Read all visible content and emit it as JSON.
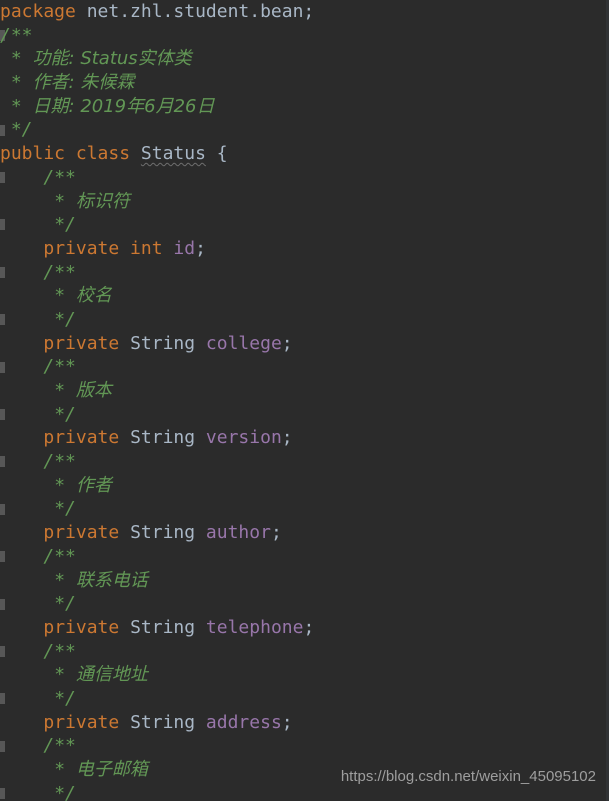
{
  "editor": {
    "theme_name": "darcula",
    "background_color": "#2b2b2b",
    "language": "java",
    "colors": {
      "keyword": "#cc7832",
      "identifier": "#a9b7c6",
      "field": "#9876aa",
      "javadoc": "#629755",
      "gutter_marker": "#575757",
      "watermark": "#9e9e9e"
    }
  },
  "watermark": {
    "text": "https://blog.csdn.net/weixin_45095102"
  },
  "code": {
    "lines": [
      {
        "indent": "",
        "tokens": [
          {
            "class": "kw",
            "text": "package"
          },
          {
            "class": "plain",
            "text": " net.zhl.student.bean;"
          }
        ]
      },
      {
        "indent": "",
        "fold": true,
        "tokens": [
          {
            "class": "doc",
            "text": "/**"
          }
        ]
      },
      {
        "indent": " ",
        "tokens": [
          {
            "class": "doc",
            "text": "* "
          },
          {
            "class": "doc-cn",
            "text": "功能: Status实体类"
          }
        ]
      },
      {
        "indent": " ",
        "tokens": [
          {
            "class": "doc",
            "text": "* "
          },
          {
            "class": "doc-cn",
            "text": "作者: 朱候霖"
          }
        ]
      },
      {
        "indent": " ",
        "tokens": [
          {
            "class": "doc",
            "text": "* "
          },
          {
            "class": "doc-cn",
            "text": "日期: 2019年6月26日"
          }
        ]
      },
      {
        "indent": " ",
        "fold": true,
        "tokens": [
          {
            "class": "doc",
            "text": "*/"
          }
        ]
      },
      {
        "indent": "",
        "tokens": [
          {
            "class": "kw",
            "text": "public class "
          },
          {
            "class": "warnref",
            "text": "Status"
          },
          {
            "class": "plain",
            "text": " {"
          }
        ]
      },
      {
        "indent": "    ",
        "fold": true,
        "tokens": [
          {
            "class": "doc",
            "text": "/**"
          }
        ]
      },
      {
        "indent": "     ",
        "tokens": [
          {
            "class": "doc",
            "text": "* "
          },
          {
            "class": "doc-cn",
            "text": "标识符"
          }
        ]
      },
      {
        "indent": "     ",
        "fold": true,
        "tokens": [
          {
            "class": "doc",
            "text": "*/"
          }
        ]
      },
      {
        "indent": "    ",
        "tokens": [
          {
            "class": "kw",
            "text": "private int "
          },
          {
            "class": "field",
            "text": "id"
          },
          {
            "class": "plain",
            "text": ";"
          }
        ]
      },
      {
        "indent": "    ",
        "fold": true,
        "tokens": [
          {
            "class": "doc",
            "text": "/**"
          }
        ]
      },
      {
        "indent": "     ",
        "tokens": [
          {
            "class": "doc",
            "text": "* "
          },
          {
            "class": "doc-cn",
            "text": "校名"
          }
        ]
      },
      {
        "indent": "     ",
        "fold": true,
        "tokens": [
          {
            "class": "doc",
            "text": "*/"
          }
        ]
      },
      {
        "indent": "    ",
        "tokens": [
          {
            "class": "kw",
            "text": "private "
          },
          {
            "class": "type",
            "text": "String "
          },
          {
            "class": "field",
            "text": "college"
          },
          {
            "class": "plain",
            "text": ";"
          }
        ]
      },
      {
        "indent": "    ",
        "fold": true,
        "tokens": [
          {
            "class": "doc",
            "text": "/**"
          }
        ]
      },
      {
        "indent": "     ",
        "tokens": [
          {
            "class": "doc",
            "text": "* "
          },
          {
            "class": "doc-cn",
            "text": "版本"
          }
        ]
      },
      {
        "indent": "     ",
        "fold": true,
        "tokens": [
          {
            "class": "doc",
            "text": "*/"
          }
        ]
      },
      {
        "indent": "    ",
        "tokens": [
          {
            "class": "kw",
            "text": "private "
          },
          {
            "class": "type",
            "text": "String "
          },
          {
            "class": "field",
            "text": "version"
          },
          {
            "class": "plain",
            "text": ";"
          }
        ]
      },
      {
        "indent": "    ",
        "fold": true,
        "tokens": [
          {
            "class": "doc",
            "text": "/**"
          }
        ]
      },
      {
        "indent": "     ",
        "tokens": [
          {
            "class": "doc",
            "text": "* "
          },
          {
            "class": "doc-cn",
            "text": "作者"
          }
        ]
      },
      {
        "indent": "     ",
        "fold": true,
        "tokens": [
          {
            "class": "doc",
            "text": "*/"
          }
        ]
      },
      {
        "indent": "    ",
        "tokens": [
          {
            "class": "kw",
            "text": "private "
          },
          {
            "class": "type",
            "text": "String "
          },
          {
            "class": "field",
            "text": "author"
          },
          {
            "class": "plain",
            "text": ";"
          }
        ]
      },
      {
        "indent": "    ",
        "fold": true,
        "tokens": [
          {
            "class": "doc",
            "text": "/**"
          }
        ]
      },
      {
        "indent": "     ",
        "tokens": [
          {
            "class": "doc",
            "text": "* "
          },
          {
            "class": "doc-cn",
            "text": "联系电话"
          }
        ]
      },
      {
        "indent": "     ",
        "fold": true,
        "tokens": [
          {
            "class": "doc",
            "text": "*/"
          }
        ]
      },
      {
        "indent": "    ",
        "tokens": [
          {
            "class": "kw",
            "text": "private "
          },
          {
            "class": "type",
            "text": "String "
          },
          {
            "class": "field",
            "text": "telephone"
          },
          {
            "class": "plain",
            "text": ";"
          }
        ]
      },
      {
        "indent": "    ",
        "fold": true,
        "tokens": [
          {
            "class": "doc",
            "text": "/**"
          }
        ]
      },
      {
        "indent": "     ",
        "tokens": [
          {
            "class": "doc",
            "text": "* "
          },
          {
            "class": "doc-cn",
            "text": "通信地址"
          }
        ]
      },
      {
        "indent": "     ",
        "fold": true,
        "tokens": [
          {
            "class": "doc",
            "text": "*/"
          }
        ]
      },
      {
        "indent": "    ",
        "tokens": [
          {
            "class": "kw",
            "text": "private "
          },
          {
            "class": "type",
            "text": "String "
          },
          {
            "class": "field",
            "text": "address"
          },
          {
            "class": "plain",
            "text": ";"
          }
        ]
      },
      {
        "indent": "    ",
        "fold": true,
        "tokens": [
          {
            "class": "doc",
            "text": "/**"
          }
        ]
      },
      {
        "indent": "     ",
        "tokens": [
          {
            "class": "doc",
            "text": "* "
          },
          {
            "class": "doc-cn",
            "text": "电子邮箱"
          }
        ]
      },
      {
        "indent": "     ",
        "fold": true,
        "tokens": [
          {
            "class": "doc",
            "text": "*/"
          }
        ]
      }
    ]
  }
}
